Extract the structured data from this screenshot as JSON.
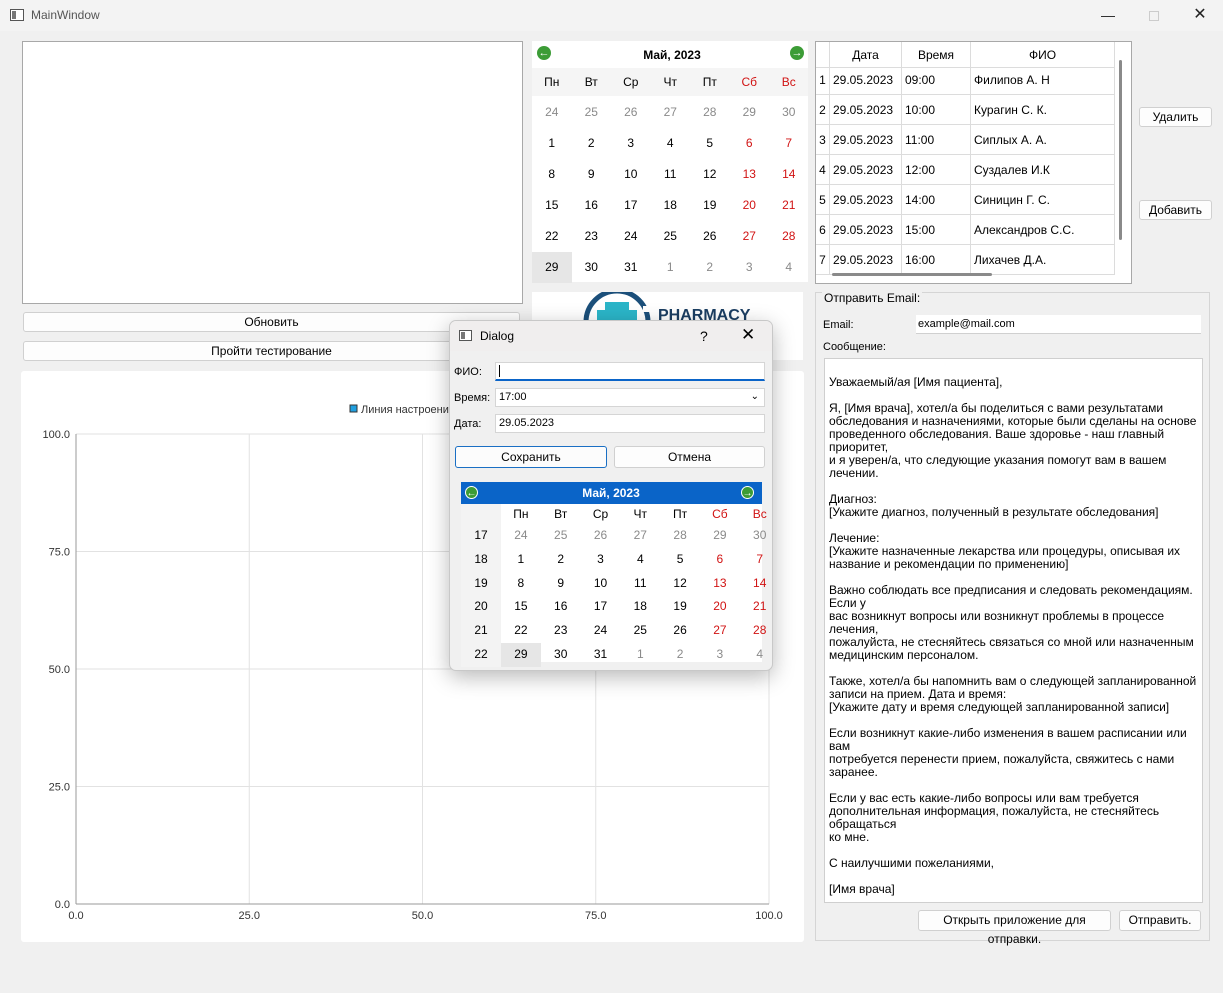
{
  "window": {
    "title": "MainWindow"
  },
  "buttons": {
    "refresh": "Обновить",
    "test": "Пройти тестирование",
    "delete": "Удалить",
    "add": "Добавить",
    "open_app": "Открыть приложение для отправки.",
    "send": "Отправить."
  },
  "calendar": {
    "month_label": "Май,  2023",
    "dow": [
      "Пн",
      "Вт",
      "Ср",
      "Чт",
      "Пт",
      "Сб",
      "Вс"
    ],
    "weeks": [
      [
        "24",
        "25",
        "26",
        "27",
        "28",
        "29",
        "30"
      ],
      [
        "1",
        "2",
        "3",
        "4",
        "5",
        "6",
        "7"
      ],
      [
        "8",
        "9",
        "10",
        "11",
        "12",
        "13",
        "14"
      ],
      [
        "15",
        "16",
        "17",
        "18",
        "19",
        "20",
        "21"
      ],
      [
        "22",
        "23",
        "24",
        "25",
        "26",
        "27",
        "28"
      ],
      [
        "29",
        "30",
        "31",
        "1",
        "2",
        "3",
        "4"
      ]
    ],
    "selected": "29"
  },
  "appointments": {
    "headers": [
      "Дата",
      "Время",
      "ФИО"
    ],
    "rows": [
      [
        "1",
        "29.05.2023",
        "09:00",
        "Филипов А. Н"
      ],
      [
        "2",
        "29.05.2023",
        "10:00",
        "Курагин С. К."
      ],
      [
        "3",
        "29.05.2023",
        "11:00",
        "Сиплых А. А."
      ],
      [
        "4",
        "29.05.2023",
        "12:00",
        "Суздалев И.К"
      ],
      [
        "5",
        "29.05.2023",
        "14:00",
        "Синицин Г. С."
      ],
      [
        "6",
        "29.05.2023",
        "15:00",
        "Александров С.С."
      ],
      [
        "7",
        "29.05.2023",
        "16:00",
        "Лихачев Д.А."
      ]
    ]
  },
  "logo": {
    "text": "PHARMACY"
  },
  "email": {
    "group_title": "Отправить Email:",
    "email_label": "Email:",
    "email_value": "example@mail.com",
    "message_label": "Сообщение:",
    "message": "Уважаемый/ая [Имя пациента],\n\nЯ, [Имя врача], хотел/а бы поделиться с вами результатами\nобследования и назначениями, которые были сделаны на основе\nпроведенного обследования. Ваше здоровье - наш главный приоритет,\nи я уверен/а, что следующие указания помогут вам в вашем лечении.\n\nДиагноз:\n[Укажите диагноз, полученный в результате обследования]\n\nЛечение:\n[Укажите назначенные лекарства или процедуры, описывая их\nназвание и рекомендации по применению]\n\nВажно соблюдать все предписания и следовать рекомендациям. Если у\nвас возникнут вопросы или возникнут проблемы в процессе лечения,\nпожалуйста, не стесняйтесь связаться со мной или назначенным\nмедицинским персоналом.\n\nТакже, хотел/а бы напомнить вам о следующей запланированной\nзаписи на прием. Дата и время:\n[Укажите дату и время следующей запланированной записи]\n\nЕсли возникнут какие-либо изменения в вашем расписании или вам\nпотребуется перенести прием, пожалуйста, свяжитесь с нами заранее.\n\nЕсли у вас есть какие-либо вопросы или вам требуется\nдополнительная информация, пожалуйста, не стесняйтесь обращаться\nко мне.\n\nС наилучшими пожеланиями,\n\n[Имя врача]"
  },
  "chart_data": {
    "type": "line",
    "series": [
      {
        "name": "Линия настроения",
        "x": [],
        "y": []
      }
    ],
    "xlim": [
      0,
      100
    ],
    "ylim": [
      0,
      100
    ],
    "xticks": [
      "0.0",
      "25.0",
      "50.0",
      "75.0",
      "100.0"
    ],
    "yticks": [
      "0.0",
      "25.0",
      "50.0",
      "75.0",
      "100.0"
    ],
    "grid": true,
    "legend_position": "top",
    "series_color": "#209fdf"
  },
  "dialog": {
    "title": "Dialog",
    "help": "?",
    "fio_label": "ФИО:",
    "fio_value": "",
    "time_label": "Время:",
    "time_value": "17:00",
    "date_label": "Дата:",
    "date_value": "29.05.2023",
    "save": "Сохранить",
    "cancel": "Отмена",
    "calendar": {
      "month_label": "Май,  2023",
      "dow": [
        "Пн",
        "Вт",
        "Ср",
        "Чт",
        "Пт",
        "Сб",
        "Вс"
      ],
      "week_numbers": [
        "17",
        "18",
        "19",
        "20",
        "21",
        "22"
      ],
      "weeks": [
        [
          "24",
          "25",
          "26",
          "27",
          "28",
          "29",
          "30"
        ],
        [
          "1",
          "2",
          "3",
          "4",
          "5",
          "6",
          "7"
        ],
        [
          "8",
          "9",
          "10",
          "11",
          "12",
          "13",
          "14"
        ],
        [
          "15",
          "16",
          "17",
          "18",
          "19",
          "20",
          "21"
        ],
        [
          "22",
          "23",
          "24",
          "25",
          "26",
          "27",
          "28"
        ],
        [
          "29",
          "30",
          "31",
          "1",
          "2",
          "3",
          "4"
        ]
      ],
      "selected": "29"
    }
  }
}
